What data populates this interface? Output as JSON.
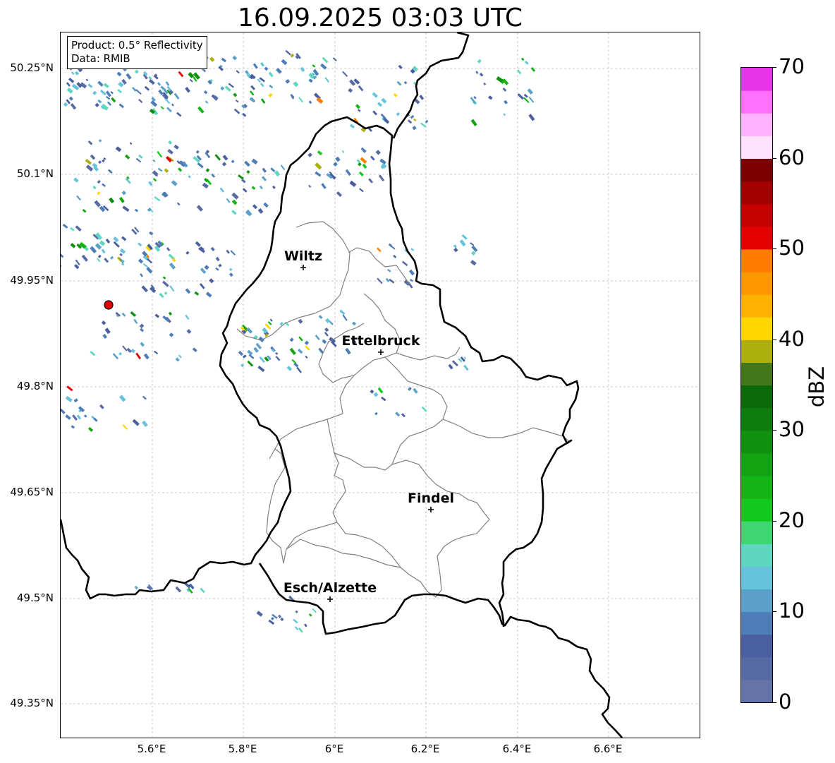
{
  "title": "16.09.2025 03:03 UTC",
  "info_box": {
    "product": "Product: 0.5° Reflectivity",
    "data": "Data: RMIB"
  },
  "lat_ticks": [
    "50.25°N",
    "50.1°N",
    "49.95°N",
    "49.8°N",
    "49.65°N",
    "49.5°N",
    "49.35°N"
  ],
  "lon_ticks": [
    "5.6°E",
    "5.8°E",
    "6°E",
    "6.2°E",
    "6.4°E",
    "6.6°E"
  ],
  "cities": [
    {
      "name": "Wiltz"
    },
    {
      "name": "Ettelbruck"
    },
    {
      "name": "Findel"
    },
    {
      "name": "Esch/Alzette"
    }
  ],
  "colorbar": {
    "label": "dBZ",
    "ticks": [
      "0",
      "10",
      "20",
      "30",
      "40",
      "50",
      "60",
      "70"
    ],
    "colors": [
      "#6474a8",
      "#566aa3",
      "#4a5f9f",
      "#4d7cb7",
      "#5aa0c8",
      "#66c3dc",
      "#5fd6c0",
      "#3dd670",
      "#14c81e",
      "#14b414",
      "#12a212",
      "#10900f",
      "#0d7d0d",
      "#0a6a0a",
      "#437719",
      "#adb00c",
      "#ffd700",
      "#ffb300",
      "#ff9800",
      "#ff7c00",
      "#e50000",
      "#c40000",
      "#a30000",
      "#7b0000",
      "#ffe2ff",
      "#ffb2ff",
      "#ff70ff",
      "#e935e9"
    ]
  },
  "radar_marker_color": "#e00000"
}
